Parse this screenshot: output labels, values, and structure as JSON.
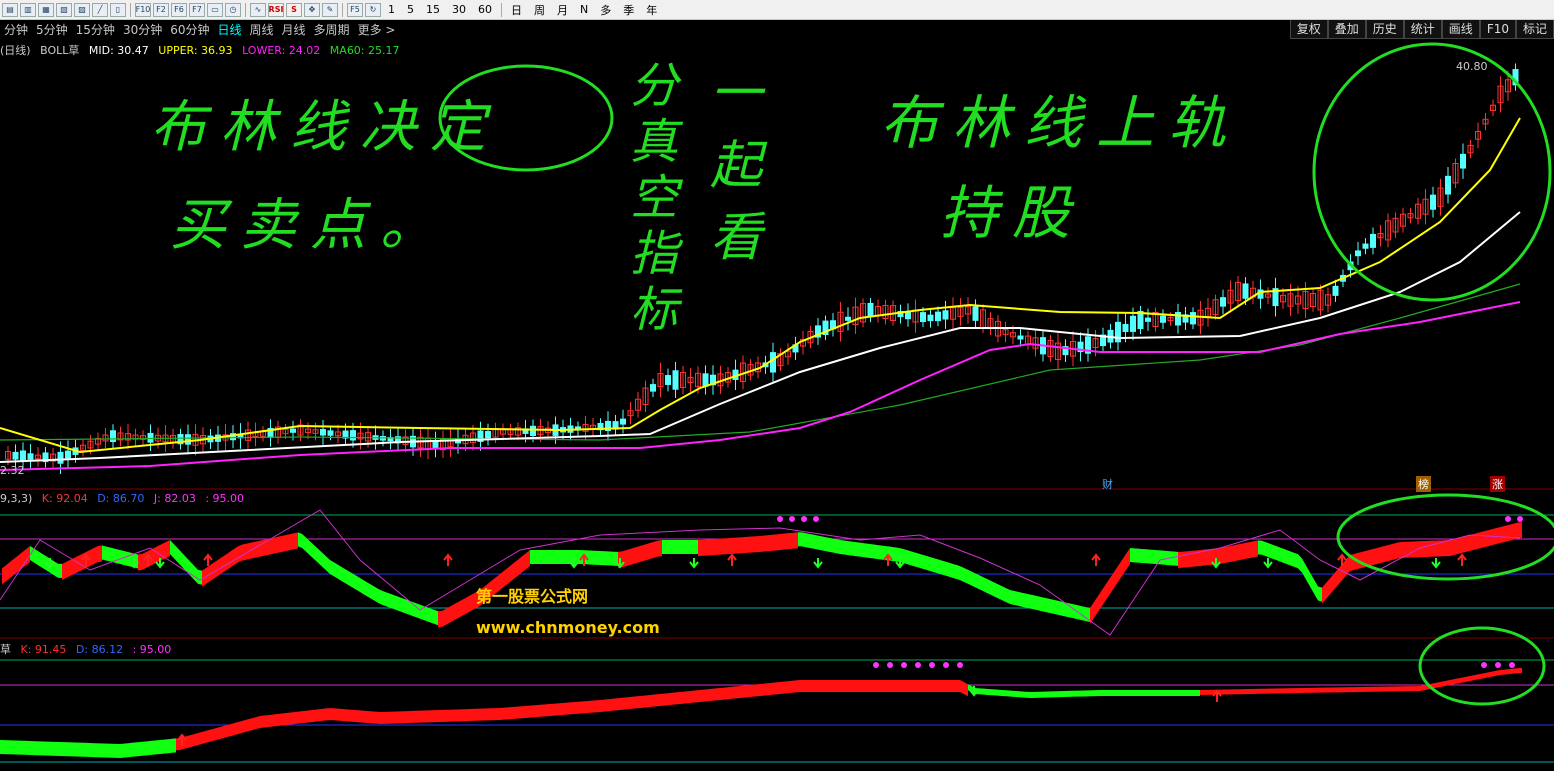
{
  "toolbar": {
    "icons": [
      "chart-icon",
      "chart-icon",
      "chart-icon",
      "chart-icon",
      "chart-icon",
      "chart-icon",
      "chart-icon",
      "chart-icon",
      "chart-icon",
      "chart-icon",
      "chart-icon",
      "chart-icon"
    ],
    "labels": [
      "F10",
      "F2",
      "F6",
      "F7",
      "RSI",
      "S",
      "F5",
      "1",
      "5",
      "15",
      "30",
      "60",
      "日",
      "周",
      "月",
      "N",
      "多",
      "季",
      "年"
    ]
  },
  "periods": [
    "分钟",
    "5分钟",
    "15分钟",
    "30分钟",
    "60分钟",
    "日线",
    "周线",
    "月线",
    "多周期",
    "更多 >"
  ],
  "active_period": "日线",
  "right_buttons": [
    "复权",
    "叠加",
    "历史",
    "统计",
    "画线",
    "F10",
    "标记"
  ],
  "main_legend": {
    "period": "(日线)",
    "name": "BOLL草",
    "mid": "MID: 30.47",
    "upper": "UPPER: 36.93",
    "lower": "LOWER: 24.02",
    "ma60": "MA60: 25.17"
  },
  "price_high": "40.80",
  "price_low": "2.32",
  "markers": {
    "cai": "财",
    "bang": "榜",
    "zhang": "涨"
  },
  "kdj_legend": {
    "params": "9,3,3)",
    "k": "K: 92.04",
    "d": "D: 86.70",
    "j": "J: 82.03",
    "level": ": 95.00"
  },
  "kd2_legend": {
    "name": "草",
    "k": "K: 91.45",
    "d": "D: 86.12",
    "level": ": 95.00"
  },
  "annotations": {
    "left_line1": "布林线决定",
    "left_line2": "买卖点。",
    "mid_col1": "分真空指标",
    "mid_col2": "一起看",
    "right_line1": "布林线上轨",
    "right_line2": "持股"
  },
  "watermark": {
    "line1": "第一股票公式网",
    "line2": "www.chnmoney.com"
  },
  "colors": {
    "upper": "#ffff00",
    "mid": "#ffffff",
    "lower": "#ff22ff",
    "ma60": "#22aa22",
    "up": "#ff3333",
    "down": "#55ffff",
    "note": "#22dd22"
  }
}
